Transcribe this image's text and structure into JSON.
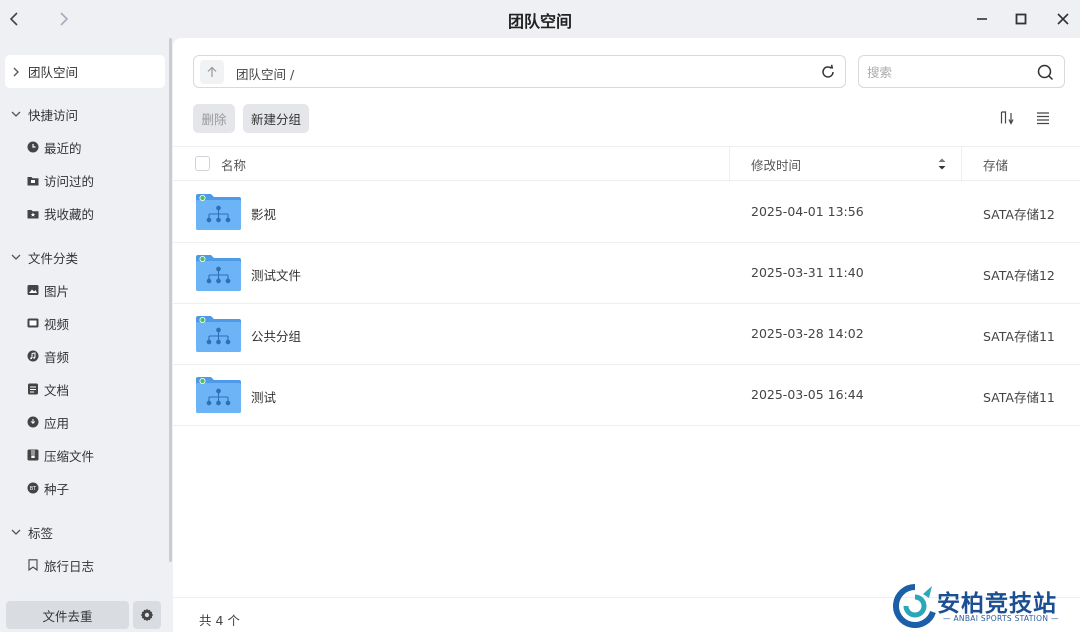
{
  "window": {
    "title": "团队空间"
  },
  "sidebar": {
    "active": {
      "label": "团队空间"
    },
    "quick_access": {
      "label": "快捷访问",
      "items": [
        {
          "label": "最近的",
          "icon": "clock-icon"
        },
        {
          "label": "访问过的",
          "icon": "folder-icon"
        },
        {
          "label": "我收藏的",
          "icon": "star-folder-icon"
        }
      ]
    },
    "file_types": {
      "label": "文件分类",
      "items": [
        {
          "label": "图片",
          "icon": "image-icon"
        },
        {
          "label": "视频",
          "icon": "video-icon"
        },
        {
          "label": "音频",
          "icon": "music-icon"
        },
        {
          "label": "文档",
          "icon": "document-icon"
        },
        {
          "label": "应用",
          "icon": "app-icon"
        },
        {
          "label": "压缩文件",
          "icon": "archive-icon"
        },
        {
          "label": "种子",
          "icon": "torrent-icon",
          "badge": "BT"
        }
      ]
    },
    "tags": {
      "label": "标签",
      "items": [
        {
          "label": "旅行日志",
          "icon": "bookmark-icon"
        }
      ]
    },
    "dedupe_label": "文件去重"
  },
  "toolbar": {
    "path": "团队空间 /",
    "search_placeholder": "搜索",
    "delete_label": "删除",
    "new_group_label": "新建分组"
  },
  "table": {
    "columns": {
      "name": "名称",
      "modified": "修改时间",
      "storage": "存储"
    },
    "rows": [
      {
        "name": "影视",
        "modified": "2025-04-01 13:56",
        "storage": "SATA存储12"
      },
      {
        "name": "测试文件",
        "modified": "2025-03-31 11:40",
        "storage": "SATA存储12"
      },
      {
        "name": "公共分组",
        "modified": "2025-03-28 14:02",
        "storage": "SATA存储11"
      },
      {
        "name": "测试",
        "modified": "2025-03-05 16:44",
        "storage": "SATA存储11"
      }
    ]
  },
  "status": {
    "count_text": "共 4 个"
  },
  "watermark": {
    "title": "安柏竞技站",
    "subtitle": "— ANBAI SPORTS STATION —"
  },
  "colors": {
    "accent": "#3d8ee6",
    "folder": "#5aa6f0",
    "online_dot": "#4cc05a"
  }
}
